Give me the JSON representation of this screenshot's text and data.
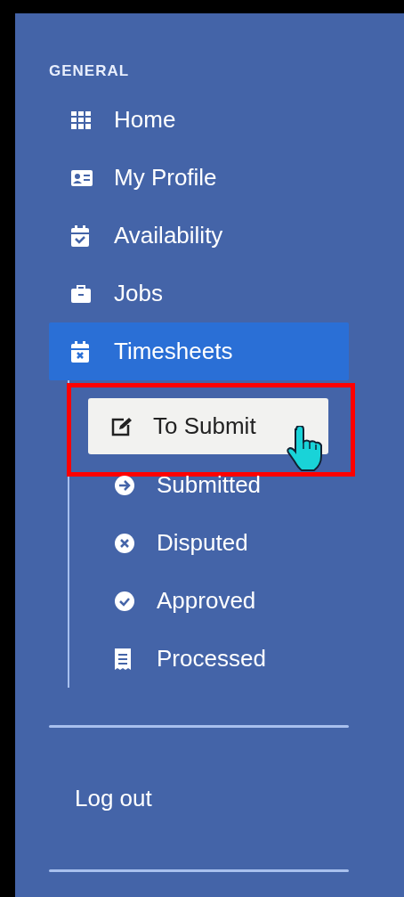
{
  "sidebar": {
    "section_label": "GENERAL",
    "items": [
      {
        "label": "Home",
        "selected": false
      },
      {
        "label": "My Profile",
        "selected": false
      },
      {
        "label": "Availability",
        "selected": false
      },
      {
        "label": "Jobs",
        "selected": false
      },
      {
        "label": "Timesheets",
        "selected": true,
        "expanded": true,
        "children": [
          {
            "label": "To Submit",
            "selected": true,
            "highlighted": true,
            "hovered": true
          },
          {
            "label": "Submitted",
            "selected": false,
            "highlighted": false,
            "hovered": false
          },
          {
            "label": "Disputed",
            "selected": false,
            "highlighted": false,
            "hovered": false
          },
          {
            "label": "Approved",
            "selected": false,
            "highlighted": false,
            "hovered": false
          },
          {
            "label": "Processed",
            "selected": false,
            "highlighted": false,
            "hovered": false
          }
        ]
      }
    ],
    "logout": "Log out"
  }
}
